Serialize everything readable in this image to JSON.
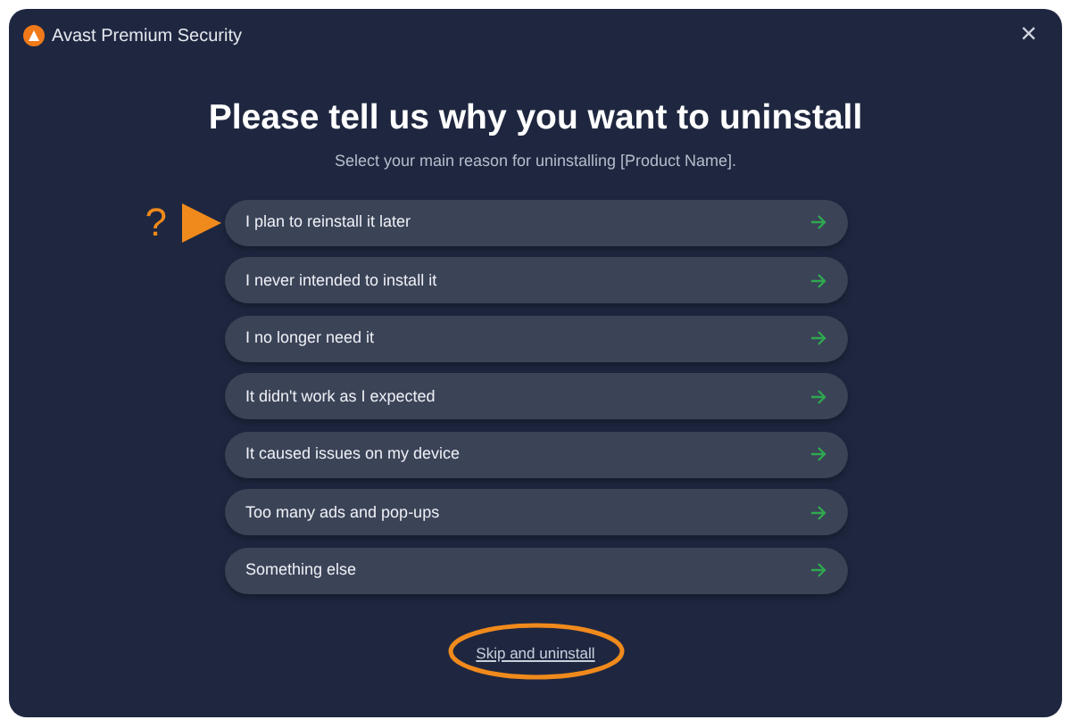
{
  "window": {
    "title": "Avast Premium Security",
    "close": "×"
  },
  "heading": "Please tell us why you want to uninstall",
  "subheading": "Select your main reason for uninstalling [Product Name].",
  "annotation": {
    "mark": "?"
  },
  "reasons": [
    {
      "label": "I plan to reinstall it later",
      "pointed": true
    },
    {
      "label": "I never intended to install it",
      "pointed": false
    },
    {
      "label": "I no longer need it",
      "pointed": false
    },
    {
      "label": "It didn't work as I expected",
      "pointed": false
    },
    {
      "label": "It caused issues on my device",
      "pointed": false
    },
    {
      "label": "Too many ads and pop-ups",
      "pointed": false
    },
    {
      "label": "Something else",
      "pointed": false
    }
  ],
  "skip_link": {
    "label": "Skip and uninstall",
    "circled": true
  }
}
